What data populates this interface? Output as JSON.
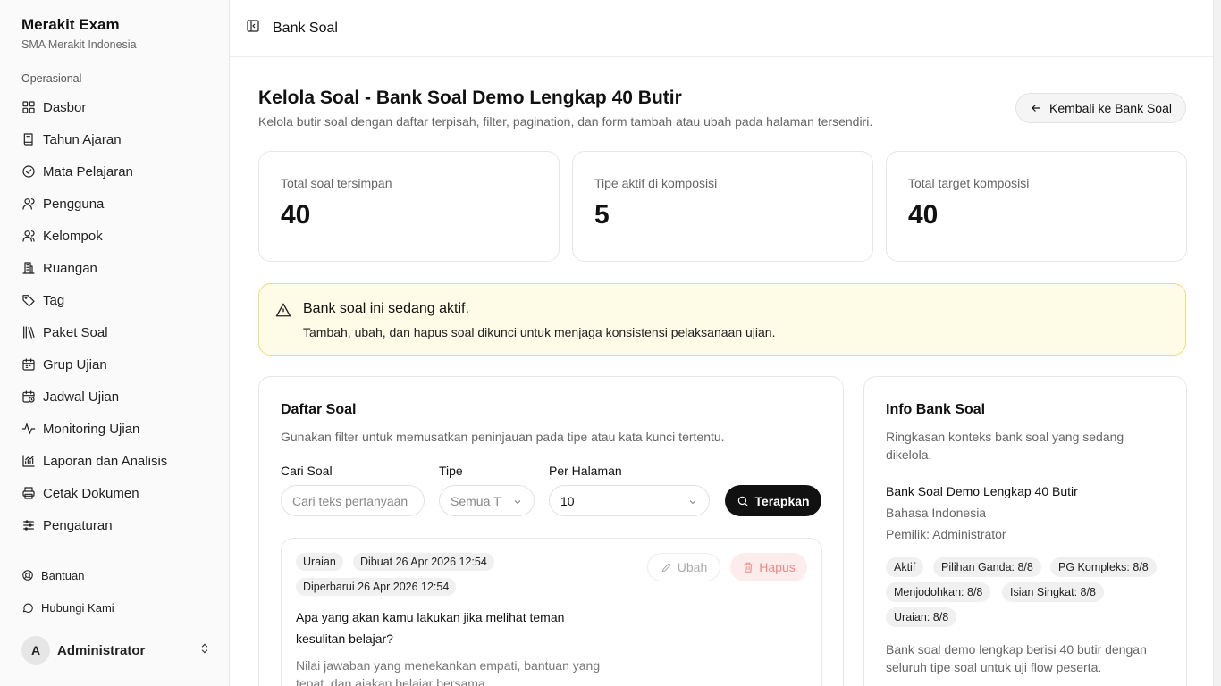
{
  "brand": {
    "title": "Merakit Exam",
    "subtitle": "SMA Merakit Indonesia"
  },
  "sidebar": {
    "section_label": "Operasional",
    "items": [
      {
        "label": "Dasbor",
        "icon": "grid-icon"
      },
      {
        "label": "Tahun Ajaran",
        "icon": "book-icon"
      },
      {
        "label": "Mata Pelajaran",
        "icon": "check-circle-icon"
      },
      {
        "label": "Pengguna",
        "icon": "user-icon"
      },
      {
        "label": "Kelompok",
        "icon": "users-icon"
      },
      {
        "label": "Ruangan",
        "icon": "building-icon"
      },
      {
        "label": "Tag",
        "icon": "tag-icon"
      },
      {
        "label": "Paket Soal",
        "icon": "library-icon"
      },
      {
        "label": "Grup Ujian",
        "icon": "calendar-icon"
      },
      {
        "label": "Jadwal Ujian",
        "icon": "calendar-clock-icon"
      },
      {
        "label": "Monitoring Ujian",
        "icon": "activity-icon"
      },
      {
        "label": "Laporan dan Analisis",
        "icon": "chart-icon"
      },
      {
        "label": "Cetak Dokumen",
        "icon": "printer-icon"
      },
      {
        "label": "Pengaturan",
        "icon": "sliders-icon"
      }
    ],
    "footer": [
      {
        "label": "Bantuan",
        "icon": "help-icon"
      },
      {
        "label": "Hubungi Kami",
        "icon": "message-icon"
      }
    ],
    "user": {
      "initial": "A",
      "name": "Administrator"
    }
  },
  "topbar": {
    "title": "Bank Soal"
  },
  "header": {
    "title": "Kelola Soal - Bank Soal Demo Lengkap 40 Butir",
    "subtitle": "Kelola butir soal dengan daftar terpisah, filter, pagination, dan form tambah atau ubah pada halaman tersendiri.",
    "back_label": "Kembali ke Bank Soal"
  },
  "stats": [
    {
      "label": "Total soal tersimpan",
      "value": "40"
    },
    {
      "label": "Tipe aktif di komposisi",
      "value": "5"
    },
    {
      "label": "Total target komposisi",
      "value": "40"
    }
  ],
  "alert": {
    "title": "Bank soal ini sedang aktif.",
    "text": "Tambah, ubah, dan hapus soal dikunci untuk menjaga konsistensi pelaksanaan ujian.",
    "color": "#fefbe6"
  },
  "list": {
    "title": "Daftar Soal",
    "subtitle": "Gunakan filter untuk memusatkan peninjauan pada tipe atau kata kunci tertentu.",
    "search_label": "Cari Soal",
    "search_placeholder": "Cari teks pertanyaan",
    "type_label": "Tipe",
    "type_value": "Semua T",
    "per_page_label": "Per Halaman",
    "per_page_value": "10",
    "apply_label": "Terapkan",
    "question": {
      "badges": [
        "Uraian",
        "Dibuat 26 Apr 2026 12:54",
        "Diperbarui 26 Apr 2026 12:54"
      ],
      "edit_label": "Ubah",
      "delete_label": "Hapus",
      "text": "Apa yang akan kamu lakukan jika melihat teman kesulitan belajar?",
      "hint": "Nilai jawaban yang menekankan empati, bantuan yang tepat, dan ajakan belajar bersama."
    }
  },
  "info": {
    "title": "Info Bank Soal",
    "subtitle": "Ringkasan konteks bank soal yang sedang dikelola.",
    "name": "Bank Soal Demo Lengkap 40 Butir",
    "subject": "Bahasa Indonesia",
    "owner": "Pemilik: Administrator",
    "tags": [
      "Aktif",
      "Pilihan Ganda: 8/8",
      "PG Kompleks: 8/8",
      "Menjodohkan: 8/8",
      "Isian Singkat: 8/8",
      "Uraian: 8/8"
    ],
    "description": "Bank soal demo lengkap berisi 40 butir dengan seluruh tipe soal untuk uji flow peserta."
  }
}
